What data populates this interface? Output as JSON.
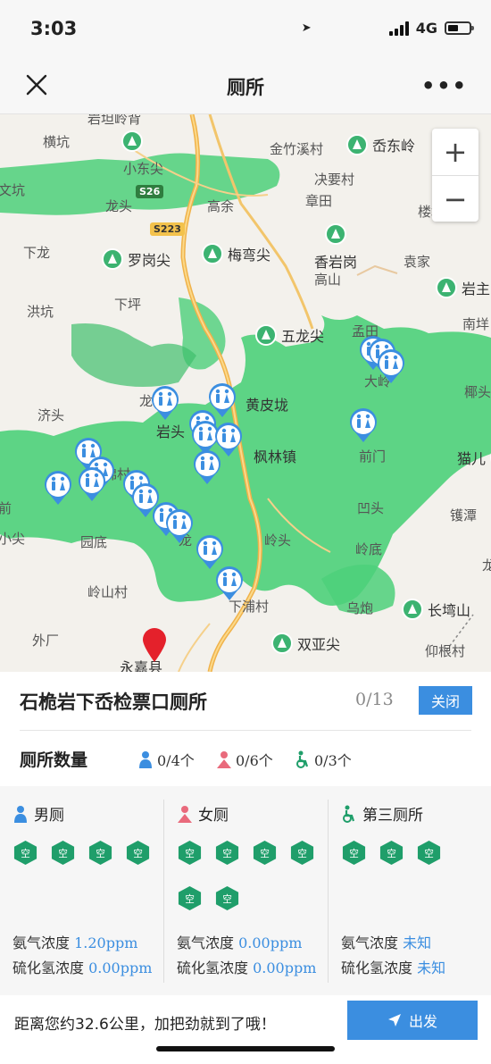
{
  "status": {
    "time": "3:03",
    "network": "4G"
  },
  "nav": {
    "title": "厕所"
  },
  "map": {
    "labels": [
      "岩坦岭背",
      "横坑",
      "小东尖",
      "金竹溪村",
      "岙东岭",
      "决要村",
      "文坑",
      "龙头",
      "高余",
      "章田",
      "楼坑",
      "下龙",
      "罗岗尖",
      "梅弯尖",
      "香岩岗",
      "袁家",
      "高山",
      "岩主",
      "洪坑",
      "下坪",
      "五龙尖",
      "孟田",
      "南垟",
      "大岭",
      "椰头",
      "济头",
      "龙",
      "岩头",
      "黄皮垅",
      "枫林镇",
      "前门",
      "猫儿",
      "前",
      "锦村",
      "凹头",
      "镬潭",
      "小尖",
      "园底",
      "龙",
      "岭头",
      "岭底",
      "龙",
      "岭山村",
      "下浦村",
      "乌炮",
      "长塆山",
      "外厂",
      "双亚尖",
      "仰根村",
      "永嘉县"
    ],
    "road_badges": [
      "S26",
      "S223"
    ],
    "zoom_in": "+",
    "zoom_out": "−"
  },
  "toilet": {
    "name": "石桅岩下岙检票口厕所",
    "page": "0/13",
    "close_label": "关闭"
  },
  "counts": {
    "title": "厕所数量",
    "male": "0/4个",
    "female": "0/6个",
    "third": "0/3个"
  },
  "columns": [
    {
      "label": "男厕",
      "stalls": 4,
      "ammonia_label": "氨气浓度",
      "ammonia": "1.20ppm",
      "h2s_label": "硫化氢浓度",
      "h2s": "0.00ppm"
    },
    {
      "label": "女厕",
      "stalls": 6,
      "ammonia_label": "氨气浓度",
      "ammonia": "0.00ppm",
      "h2s_label": "硫化氢浓度",
      "h2s": "0.00ppm"
    },
    {
      "label": "第三厕所",
      "stalls": 3,
      "ammonia_label": "氨气浓度",
      "ammonia": "未知",
      "h2s_label": "硫化氢浓度",
      "h2s": "未知"
    }
  ],
  "stall_status": "空",
  "footer": {
    "distance_text": "距离您约32.6公里，加把劲就到了哦！",
    "go_label": "出发"
  },
  "colors": {
    "accent": "#3b8ee0",
    "stall_green": "#1f9e6a",
    "male_icon": "#3b8ee0",
    "female_icon": "#e96a7c",
    "third_icon": "#1f9e6a",
    "forest": "#4cd07a"
  }
}
